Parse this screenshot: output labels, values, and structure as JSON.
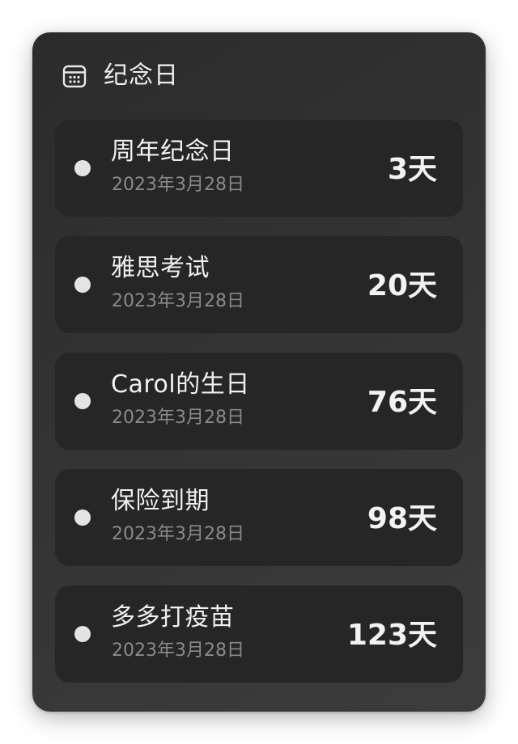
{
  "widget": {
    "title": "纪念日",
    "icon": "calendar-icon"
  },
  "events": [
    {
      "name": "周年纪念日",
      "date": "2023年3月28日",
      "countdown": "3天"
    },
    {
      "name": "雅思考试",
      "date": "2023年3月28日",
      "countdown": "20天"
    },
    {
      "name": "Carol的生日",
      "date": "2023年3月28日",
      "countdown": "76天"
    },
    {
      "name": "保险到期",
      "date": "2023年3月28日",
      "countdown": "98天"
    },
    {
      "name": "多多打疫苗",
      "date": "2023年3月28日",
      "countdown": "123天"
    }
  ],
  "colors": {
    "widget_background": "#333333",
    "card_background": "#262626",
    "primary_text": "#f0f0f0",
    "secondary_text": "#8a8a8a",
    "dot": "#e4e4e4"
  }
}
